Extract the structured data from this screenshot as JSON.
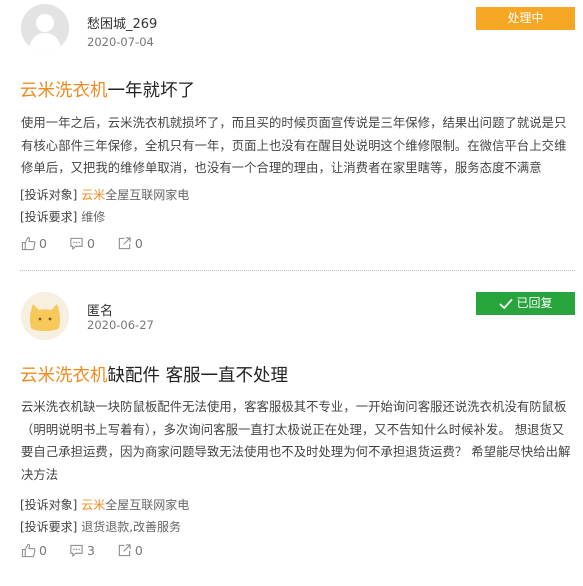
{
  "complaints": [
    {
      "user": "愁困城_269",
      "date": "2020-07-04",
      "status": "处理中",
      "status_color": "#f5a623",
      "title_highlight": "云米洗衣机",
      "title_rest": "一年就坏了",
      "body": "使用一年之后，云米洗衣机就损坏了，而且买的时候页面宣传说是三年保修，结果出问题了就说是只有核心部件三年保修，全机只有一年，页面上也没有在醒目处说明这个维修限制。在微信平台上交维修单后，又把我的维修单取消，也没有一个合理的理由，让消费者在家里瞎等，服务态度不满意",
      "target_label": "[投诉对象]",
      "target_brand": "云米",
      "target_rest": "全屋互联网家电",
      "request_label": "[投诉要求]",
      "request_value": "维修",
      "likes": "0",
      "comments": "0",
      "shares": "0",
      "avatar_icon": "default-user-icon"
    },
    {
      "user": "匿名",
      "date": "2020-06-27",
      "status": "已回复",
      "status_color": "#27a53c",
      "title_highlight": "云米洗衣机",
      "title_rest": "缺配件 客服一直不处理",
      "body": "云米洗衣机缺一块防鼠板配件无法使用，客客服极其不专业，一开始询问客服还说洗衣机没有防鼠板（明明说明书上写着有），多次询问客服一直打太极说正在处理，又不告知什么时候补发。 想退货又要自己承担运费，因为商家问题导致无法使用也不及时处理为何不承担退货运费？ 希望能尽快给出解决方法",
      "target_label": "[投诉对象]",
      "target_brand": "云米",
      "target_rest": "全屋互联网家电",
      "request_label": "[投诉要求]",
      "request_value": "退货退款,改善服务",
      "likes": "0",
      "comments": "3",
      "shares": "0",
      "avatar_icon": "cat-avatar-icon"
    }
  ]
}
